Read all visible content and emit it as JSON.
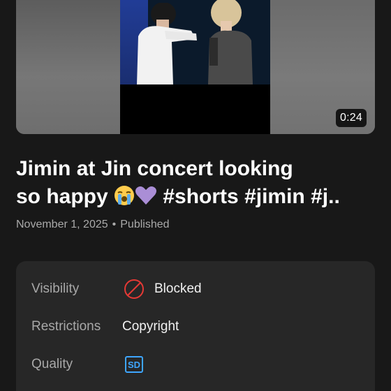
{
  "video": {
    "duration": "0:24",
    "title_line1": "Jimin at Jin concert looking",
    "title_line2_text_a": "so happy ",
    "title_line2_text_b": " #shorts #jimin #j..",
    "emoji_1": "loudly-crying-face",
    "emoji_2": "purple-heart",
    "date": "November 1, 2025",
    "separator": "•",
    "status": "Published"
  },
  "details": {
    "visibility_label": "Visibility",
    "visibility_value": "Blocked",
    "visibility_icon": "blocked-icon",
    "restrictions_label": "Restrictions",
    "restrictions_value": "Copyright",
    "quality_label": "Quality",
    "quality_icon": "sd-badge-icon",
    "quality_badge_text": "SD"
  },
  "colors": {
    "background": "#181818",
    "card": "#272727",
    "blocked_red": "#e53935",
    "sd_blue": "#3ea6ff"
  }
}
